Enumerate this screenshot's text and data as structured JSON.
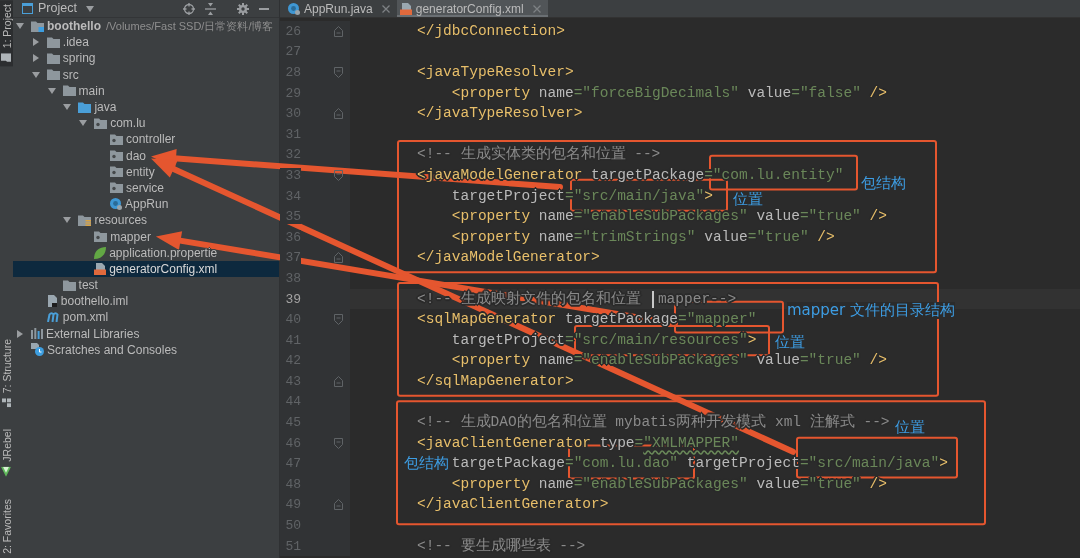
{
  "tool_stripe": [
    {
      "label": "1: Project",
      "kind": "project",
      "selected": true
    },
    {
      "label": "7: Structure",
      "kind": "structure",
      "selected": false
    },
    {
      "label": "JRebel",
      "kind": "jrebel",
      "selected": false
    },
    {
      "label": "2: Favorites",
      "kind": "favorites",
      "selected": false
    }
  ],
  "project_panel": {
    "title": "Project",
    "tree": [
      {
        "label": "boothello",
        "path": "/Volumes/Fast SSD/日常资料/博客",
        "kind": "module",
        "expanded": true,
        "selected": false,
        "children": [
          {
            "label": ".idea",
            "kind": "folder",
            "expanded": false,
            "selected": false
          },
          {
            "label": "spring",
            "kind": "folder",
            "expanded": false,
            "selected": false
          },
          {
            "label": "src",
            "kind": "folder",
            "expanded": true,
            "selected": false,
            "children": [
              {
                "label": "main",
                "kind": "folder",
                "expanded": true,
                "selected": false,
                "children": [
                  {
                    "label": "java",
                    "kind": "source_folder",
                    "expanded": true,
                    "selected": false,
                    "children": [
                      {
                        "label": "com.lu",
                        "kind": "package",
                        "expanded": true,
                        "selected": false,
                        "children": [
                          {
                            "label": "controller",
                            "kind": "package",
                            "selected": false
                          },
                          {
                            "label": "dao",
                            "kind": "package",
                            "selected": false
                          },
                          {
                            "label": "entity",
                            "kind": "package",
                            "selected": false
                          },
                          {
                            "label": "service",
                            "kind": "package",
                            "selected": false
                          },
                          {
                            "label": "AppRun",
                            "kind": "class",
                            "selected": false
                          }
                        ]
                      }
                    ]
                  },
                  {
                    "label": "resources",
                    "kind": "resources_folder",
                    "expanded": true,
                    "selected": false,
                    "children": [
                      {
                        "label": "mapper",
                        "kind": "package",
                        "selected": false
                      },
                      {
                        "label": "application.propertie",
                        "kind": "properties",
                        "selected": false
                      },
                      {
                        "label": "generatorConfig.xml",
                        "kind": "xml",
                        "selected": true
                      }
                    ]
                  }
                ]
              },
              {
                "label": "test",
                "kind": "folder",
                "selected": false
              }
            ]
          },
          {
            "label": "boothello.iml",
            "kind": "iml",
            "selected": false
          },
          {
            "label": "pom.xml",
            "kind": "pom",
            "selected": false
          }
        ]
      },
      {
        "label": "External Libraries",
        "kind": "libraries",
        "expanded": false,
        "selected": false
      },
      {
        "label": "Scratches and Consoles",
        "kind": "scratches",
        "selected": false
      }
    ]
  },
  "editor": {
    "tabs": [
      {
        "label": "AppRun.java",
        "kind": "class",
        "selected": false
      },
      {
        "label": "generatorConfig.xml",
        "kind": "xml",
        "selected": true
      }
    ],
    "lines": [
      {
        "number": "26",
        "kind": "markup",
        "text": "</jdbcConnection>",
        "fold_start": false,
        "fold_end": true,
        "current": false,
        "warning": false
      },
      {
        "number": "27",
        "fold_start": false,
        "fold_end": false,
        "current": false
      },
      {
        "number": "28",
        "kind": "markup",
        "text": "<javaTypeResolver>",
        "fold_start": true,
        "fold_end": false,
        "current": false,
        "warning": false
      },
      {
        "number": "29",
        "kind": "markup",
        "text": "    <property name=\"forceBigDecimals\" value=\"false\" />",
        "fold_start": false,
        "fold_end": false,
        "current": false,
        "warning": false
      },
      {
        "number": "30",
        "kind": "markup",
        "text": "</javaTypeResolver>",
        "fold_start": false,
        "fold_end": true,
        "current": false,
        "warning": false
      },
      {
        "number": "31",
        "fold_start": false,
        "fold_end": false,
        "current": false
      },
      {
        "number": "32",
        "kind": "comment",
        "text": "<!-- 生成实体类的包名和位置 -->",
        "fold_start": false,
        "fold_end": false,
        "current": false,
        "warning": false
      },
      {
        "number": "33",
        "kind": "markup",
        "text": "<javaModelGenerator targetPackage=\"com.lu.entity\"",
        "fold_start": true,
        "fold_end": false,
        "current": false,
        "warning": false
      },
      {
        "number": "34",
        "kind": "markup",
        "text": "    targetProject=\"src/main/java\">",
        "fold_start": false,
        "fold_end": false,
        "current": false,
        "warning": false
      },
      {
        "number": "35",
        "kind": "markup",
        "text": "    <property name=\"enableSubPackages\" value=\"true\" />",
        "fold_start": false,
        "fold_end": false,
        "current": false,
        "warning": false
      },
      {
        "number": "36",
        "kind": "markup",
        "text": "    <property name=\"trimStrings\" value=\"true\" />",
        "fold_start": false,
        "fold_end": false,
        "current": false,
        "warning": false
      },
      {
        "number": "37",
        "kind": "markup",
        "text": "</javaModelGenerator>",
        "fold_start": false,
        "fold_end": true,
        "current": false,
        "warning": false
      },
      {
        "number": "38",
        "fold_start": false,
        "fold_end": false,
        "current": false
      },
      {
        "number": "39",
        "kind": "comment",
        "text": "<!-- 生成映射文件的包名和位置  mapper-->",
        "fold_start": false,
        "fold_end": false,
        "current": true,
        "warning": false
      },
      {
        "number": "40",
        "kind": "markup",
        "text": "<sqlMapGenerator targetPackage=\"mapper\"",
        "fold_start": true,
        "fold_end": false,
        "current": false,
        "warning": false
      },
      {
        "number": "41",
        "kind": "markup",
        "text": "    targetProject=\"src/main/resources\">",
        "fold_start": false,
        "fold_end": false,
        "current": false,
        "warning": false
      },
      {
        "number": "42",
        "kind": "markup",
        "text": "    <property name=\"enableSubPackages\" value=\"true\" />",
        "fold_start": false,
        "fold_end": false,
        "current": false,
        "warning": false
      },
      {
        "number": "43",
        "kind": "markup",
        "text": "</sqlMapGenerator>",
        "fold_start": false,
        "fold_end": true,
        "current": false,
        "warning": false
      },
      {
        "number": "44",
        "fold_start": false,
        "fold_end": false,
        "current": false
      },
      {
        "number": "45",
        "kind": "comment",
        "text": "<!-- 生成DAO的包名和位置 mybatis两种开发模式 xml 注解式 -->",
        "fold_start": false,
        "fold_end": false,
        "current": false,
        "warning": false
      },
      {
        "number": "46",
        "kind": "markup",
        "text": "<javaClientGenerator type=\"XMLMAPPER\"",
        "fold_start": true,
        "fold_end": false,
        "current": false,
        "warning": true
      },
      {
        "number": "47",
        "kind": "markup",
        "text": "    targetPackage=\"com.lu.dao\" targetProject=\"src/main/java\">",
        "fold_start": false,
        "fold_end": false,
        "current": false,
        "warning": false
      },
      {
        "number": "48",
        "kind": "markup",
        "text": "    <property name=\"enableSubPackages\" value=\"true\" />",
        "fold_start": false,
        "fold_end": false,
        "current": false,
        "warning": false
      },
      {
        "number": "49",
        "kind": "markup",
        "text": "</javaClientGenerator>",
        "fold_start": false,
        "fold_end": true,
        "current": false,
        "warning": false
      },
      {
        "number": "50",
        "fold_start": false,
        "fold_end": false,
        "current": false
      },
      {
        "number": "51",
        "kind": "comment",
        "text": "<!-- 要生成哪些表 -->",
        "fold_start": false,
        "fold_end": false,
        "current": false,
        "warning": false
      }
    ]
  },
  "annotations": [
    {
      "text": "包结构"
    },
    {
      "text": "位置"
    },
    {
      "text": "mapper 文件的目录结构"
    },
    {
      "text": "位置"
    },
    {
      "text": "位置"
    },
    {
      "text": "包结构"
    }
  ]
}
